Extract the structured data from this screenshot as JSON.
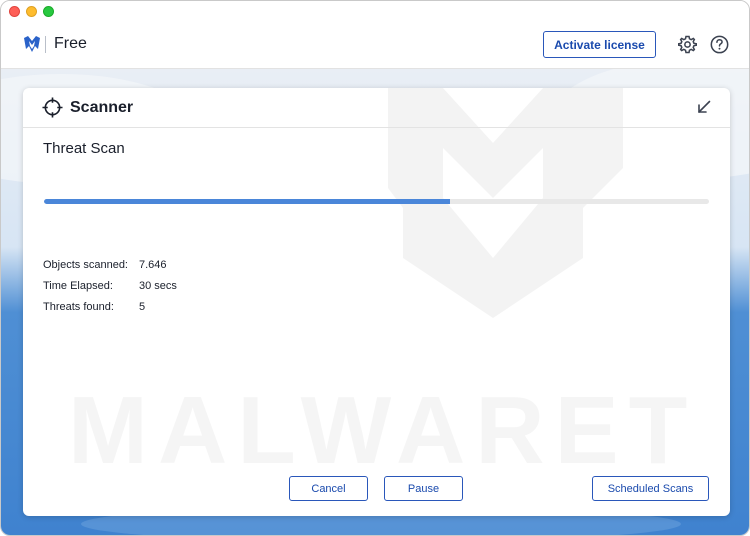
{
  "header": {
    "edition": "Free",
    "activate_label": "Activate license",
    "icons": {
      "logo": "malwarebytes-logo-icon",
      "settings": "gear-icon",
      "help": "help-icon"
    }
  },
  "scanner": {
    "title": "Scanner",
    "scan_name": "Threat Scan",
    "progress": 0.61,
    "stats": [
      {
        "label": "Objects scanned:",
        "value": "7.646"
      },
      {
        "label": "Time Elapsed:",
        "value": "30 secs"
      },
      {
        "label": "Threats found:",
        "value": "5"
      }
    ],
    "buttons": {
      "cancel": "Cancel",
      "pause": "Pause",
      "scheduled": "Scheduled Scans"
    },
    "watermark_text": "MALWARET"
  },
  "colors": {
    "accent": "#1a4aad",
    "progress": "#4a86d9",
    "background_blue": "#3f82cf"
  }
}
